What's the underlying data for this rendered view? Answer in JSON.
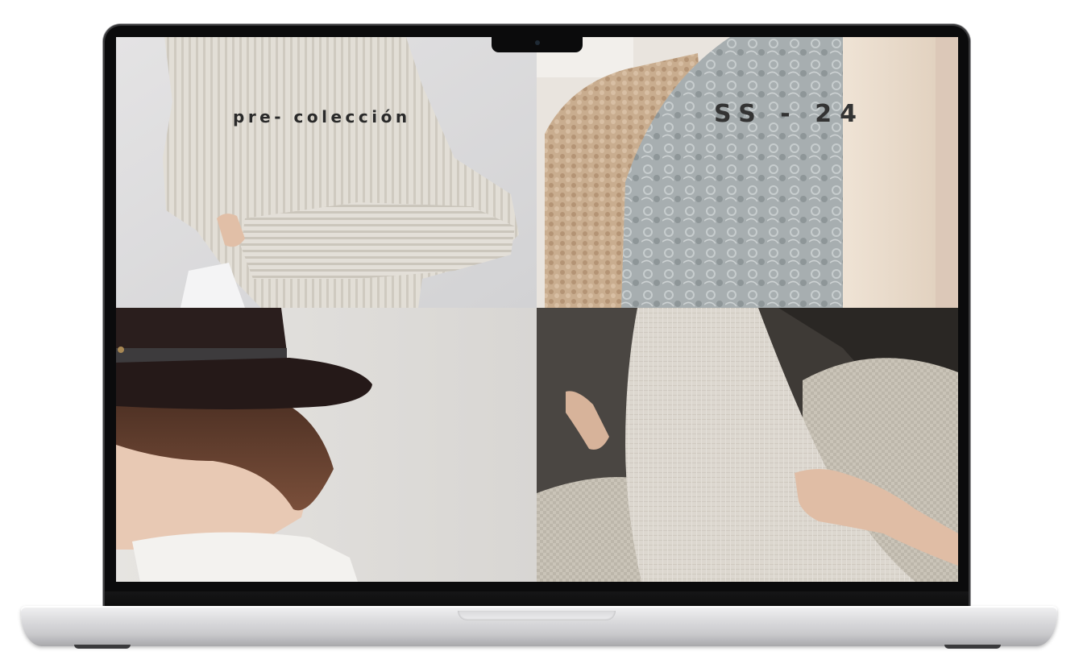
{
  "page": {
    "tiles": [
      {
        "name": "sweater-photo",
        "label": "pre- colección"
      },
      {
        "name": "lace-knit-photo",
        "label": "SS - 24"
      },
      {
        "name": "hat-woman-photo"
      },
      {
        "name": "linen-trousers-photo"
      }
    ]
  },
  "colors": {
    "bezel": "#0b0b0c",
    "base": "#d6d6d8",
    "text": "#2a2a2a"
  }
}
